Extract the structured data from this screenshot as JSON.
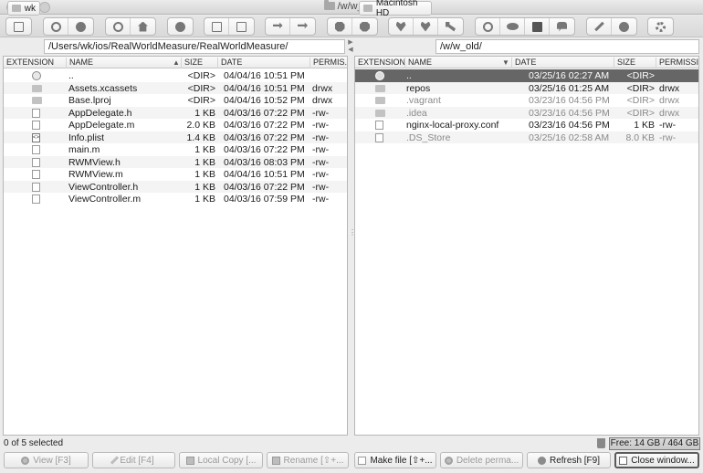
{
  "window": {
    "title": "/w/w_old/"
  },
  "toolbar": {
    "groups": [
      [
        "new-window-icon"
      ],
      [
        "back-icon",
        "forward-icon"
      ],
      [
        "root-icon",
        "home-icon"
      ],
      [
        "stop-icon"
      ],
      [
        "new-folder-icon",
        "new-file-icon"
      ],
      [
        "sync-icon",
        "compare-icon"
      ],
      [
        "bookmark-icon",
        "bookmark-add-icon"
      ],
      [
        "favorite-icon",
        "favorite-add-icon",
        "key-icon"
      ],
      [
        "network-icon",
        "visibility-icon",
        "terminal-icon",
        "console-icon"
      ],
      [
        "magic-wand-icon",
        "record-icon"
      ],
      [
        "settings-icon"
      ]
    ]
  },
  "left": {
    "volume": "wk",
    "path": "/Users/wk/ios/RealWorldMeasure/RealWorldMeasure/",
    "columns": {
      "ext": "EXTENSION",
      "name": "NAME",
      "size": "SIZE",
      "date": "DATE",
      "perm": "PERMIS..."
    },
    "rows": [
      {
        "icon": "up",
        "name": "..",
        "size": "<DIR>",
        "date": "04/04/16 10:51 PM",
        "perm": ""
      },
      {
        "icon": "folder",
        "name": "Assets.xcassets",
        "size": "<DIR>",
        "date": "04/04/16 10:51 PM",
        "perm": "drwx"
      },
      {
        "icon": "folder",
        "name": "Base.lproj",
        "size": "<DIR>",
        "date": "04/04/16 10:52 PM",
        "perm": "drwx"
      },
      {
        "icon": "file",
        "name": "AppDelegate.h",
        "size": "1 KB",
        "date": "04/03/16 07:22 PM",
        "perm": "-rw-"
      },
      {
        "icon": "file",
        "name": "AppDelegate.m",
        "size": "2.0 KB",
        "date": "04/03/16 07:22 PM",
        "perm": "-rw-"
      },
      {
        "icon": "code",
        "name": "Info.plist",
        "size": "1.4 KB",
        "date": "04/03/16 07:22 PM",
        "perm": "-rw-"
      },
      {
        "icon": "file",
        "name": "main.m",
        "size": "1 KB",
        "date": "04/03/16 07:22 PM",
        "perm": "-rw-"
      },
      {
        "icon": "file",
        "name": "RWMView.h",
        "size": "1 KB",
        "date": "04/03/16 08:03 PM",
        "perm": "-rw-"
      },
      {
        "icon": "file",
        "name": "RWMView.m",
        "size": "1 KB",
        "date": "04/04/16 10:51 PM",
        "perm": "-rw-"
      },
      {
        "icon": "file",
        "name": "ViewController.h",
        "size": "1 KB",
        "date": "04/03/16 07:22 PM",
        "perm": "-rw-"
      },
      {
        "icon": "file",
        "name": "ViewController.m",
        "size": "1 KB",
        "date": "04/03/16 07:59 PM",
        "perm": "-rw-"
      }
    ]
  },
  "right": {
    "volume": "Macintosh HD",
    "path": "/w/w_old/",
    "columns": {
      "ext": "EXTENSION",
      "name": "NAME",
      "date": "DATE",
      "size": "SIZE",
      "perm": "PERMISSI..."
    },
    "rows": [
      {
        "icon": "up",
        "name": "..",
        "date": "03/25/16 02:27 AM",
        "size": "<DIR>",
        "perm": "",
        "selected": true,
        "dim": false
      },
      {
        "icon": "folder",
        "name": "repos",
        "date": "03/25/16 01:25 AM",
        "size": "<DIR>",
        "perm": "drwx",
        "selected": false,
        "dim": false
      },
      {
        "icon": "folder",
        "name": ".vagrant",
        "date": "03/23/16 04:56 PM",
        "size": "<DIR>",
        "perm": "drwx",
        "selected": false,
        "dim": true
      },
      {
        "icon": "folder",
        "name": ".idea",
        "date": "03/23/16 04:56 PM",
        "size": "<DIR>",
        "perm": "drwx",
        "selected": false,
        "dim": true
      },
      {
        "icon": "gearfile",
        "name": "nginx-local-proxy.conf",
        "date": "03/23/16 04:56 PM",
        "size": "1 KB",
        "perm": "-rw-",
        "selected": false,
        "dim": false
      },
      {
        "icon": "file",
        "name": ".DS_Store",
        "date": "03/25/16 02:58 AM",
        "size": "8.0 KB",
        "perm": "-rw-",
        "selected": false,
        "dim": true
      }
    ]
  },
  "status": {
    "selection": "0 of 5 selected",
    "free": "Free: 14 GB / 464 GB"
  },
  "buttons": {
    "view": "View [F3]",
    "edit": "Edit [F4]",
    "copy": "Local Copy [...",
    "rename": "Rename [⇧+...",
    "make_file": "Make file [⇧+...",
    "delete": "Delete perma...",
    "refresh": "Refresh [F9]",
    "close": "Close window..."
  }
}
